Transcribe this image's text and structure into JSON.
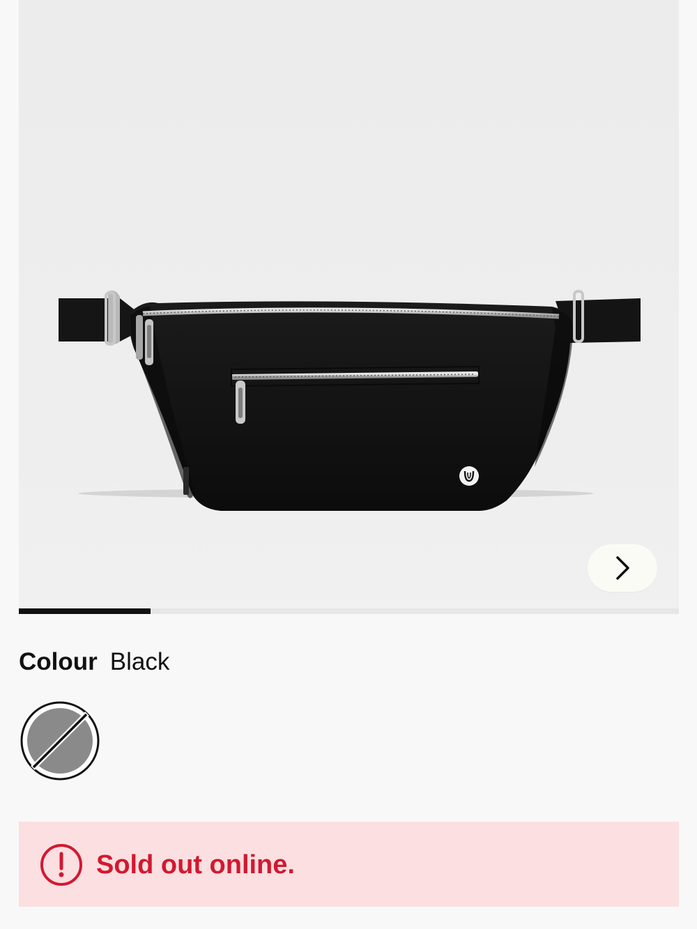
{
  "gallery": {
    "image_alt": "black belt bag",
    "next_icon": "chevron-right-icon",
    "progress": 0.2,
    "image_index": 1,
    "image_count": 5
  },
  "colour": {
    "label": "Colour",
    "value": "Black",
    "swatch_icon": "unavailable-swatch-icon",
    "swatch_color": "#8a8a8a"
  },
  "alert": {
    "icon": "exclamation-circle-icon",
    "message": "Sold out online.",
    "text_color": "#d31830",
    "background": "#fbdfe1"
  }
}
